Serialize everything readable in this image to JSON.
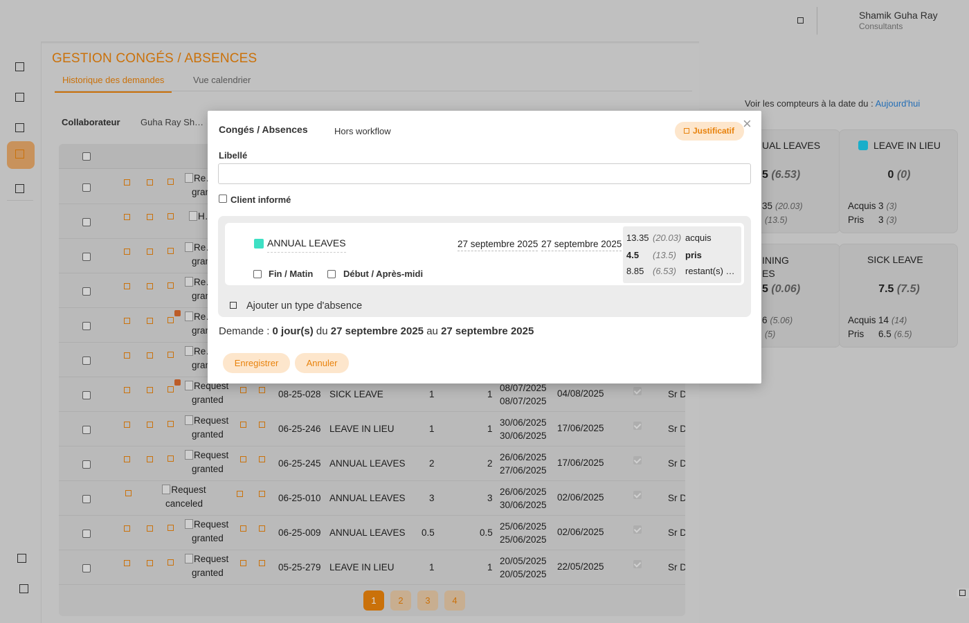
{
  "header": {
    "user_name": "Shamik Guha Ray",
    "user_role": "Consultants"
  },
  "page": {
    "title": "GESTION CONGÉS / ABSENCES",
    "tabs": [
      "Historique des demandes",
      "Vue calendrier"
    ],
    "filter_label": "Collaborateur",
    "filter_value": "Guha Ray Sh…"
  },
  "table": {
    "rows": [
      {
        "status": "Re…",
        "status2": "gran",
        "ref": "",
        "type": "",
        "q1": "",
        "q2": "",
        "dates": [
          "",
          ""
        ],
        "created": "",
        "approver": "",
        "dot": false
      },
      {
        "status": "H…",
        "status2": "",
        "ref": "",
        "type": "",
        "q1": "",
        "q2": "",
        "dates": [
          "",
          ""
        ],
        "created": "",
        "approver": "",
        "dot": false
      },
      {
        "status": "Re…",
        "status2": "gran",
        "ref": "",
        "type": "",
        "q1": "",
        "q2": "",
        "dates": [
          "",
          ""
        ],
        "created": "",
        "approver": "",
        "dot": false
      },
      {
        "status": "Re…",
        "status2": "gran",
        "ref": "",
        "type": "",
        "q1": "",
        "q2": "",
        "dates": [
          "",
          ""
        ],
        "created": "",
        "approver": "",
        "dot": false
      },
      {
        "status": "Re…",
        "status2": "gran",
        "ref": "",
        "type": "",
        "q1": "",
        "q2": "",
        "dates": [
          "",
          ""
        ],
        "created": "",
        "approver": "",
        "dot": true
      },
      {
        "status": "Re…",
        "status2": "gran",
        "ref": "",
        "type": "",
        "q1": "",
        "q2": "",
        "dates": [
          "",
          ""
        ],
        "created": "",
        "approver": "",
        "dot": false
      },
      {
        "status": "Request",
        "status2": "granted",
        "ref": "08-25-028",
        "type": "SICK LEAVE",
        "q1": "1",
        "q2": "1",
        "dates": [
          "08/07/2025",
          "08/07/2025"
        ],
        "created": "04/08/2025",
        "approver": "Sr D",
        "dot": true
      },
      {
        "status": "Request",
        "status2": "granted",
        "ref": "06-25-246",
        "type": "LEAVE IN LIEU",
        "q1": "1",
        "q2": "1",
        "dates": [
          "30/06/2025",
          "30/06/2025"
        ],
        "created": "17/06/2025",
        "approver": "Sr D",
        "dot": false
      },
      {
        "status": "Request",
        "status2": "granted",
        "ref": "06-25-245",
        "type": "ANNUAL LEAVES",
        "q1": "2",
        "q2": "2",
        "dates": [
          "26/06/2025",
          "27/06/2025"
        ],
        "created": "17/06/2025",
        "approver": "Sr D",
        "dot": false
      },
      {
        "status": "Request",
        "status2": "canceled",
        "ref": "06-25-010",
        "type": "ANNUAL LEAVES",
        "q1": "3",
        "q2": "3",
        "dates": [
          "26/06/2025",
          "30/06/2025"
        ],
        "created": "02/06/2025",
        "approver": "Sr D",
        "dot": false,
        "canceled": true
      },
      {
        "status": "Request",
        "status2": "granted",
        "ref": "06-25-009",
        "type": "ANNUAL LEAVES",
        "q1": "0.5",
        "q2": "0.5",
        "dates": [
          "25/06/2025",
          "25/06/2025"
        ],
        "created": "02/06/2025",
        "approver": "Sr D",
        "dot": false
      },
      {
        "status": "Request",
        "status2": "granted",
        "ref": "05-25-279",
        "type": "LEAVE IN LIEU",
        "q1": "1",
        "q2": "1",
        "dates": [
          "20/05/2025",
          "20/05/2025"
        ],
        "created": "22/05/2025",
        "approver": "Sr D",
        "dot": false
      }
    ],
    "pages": [
      "1",
      "2",
      "3",
      "4"
    ],
    "current_page": "1"
  },
  "counters": {
    "label": "Voir les compteurs à la date du :",
    "link": "Aujourd'hui",
    "cards": [
      {
        "title": "UAL LEAVES",
        "main": "5",
        "main_paren": "(6.53)",
        "rows": [
          [
            "",
            "35",
            "(20.03)"
          ],
          [
            "",
            "",
            "(13.5)"
          ]
        ],
        "swatch": ""
      },
      {
        "title": "LEAVE IN LIEU",
        "main": "0",
        "main_paren": "(0)",
        "rows": [
          [
            "Acquis",
            "3",
            "(3)"
          ],
          [
            "Pris",
            "3",
            "(3)"
          ]
        ],
        "swatch": "#1ec8e8"
      },
      {
        "title": "INING",
        "title2": "ES",
        "main": "5",
        "main_paren": "(0.06)",
        "rows": [
          [
            "",
            "6",
            "(5.06)"
          ],
          [
            "",
            "",
            "(5)"
          ]
        ],
        "swatch": ""
      },
      {
        "title": "SICK LEAVE",
        "main": "7.5",
        "main_paren": "(7.5)",
        "rows": [
          [
            "Acquis",
            "14",
            "(14)"
          ],
          [
            "Pris",
            "6.5",
            "(6.5)"
          ]
        ],
        "swatch": "#d4d4d4"
      }
    ]
  },
  "modal": {
    "title": "Congés / Absences",
    "workflow": "Hors workflow",
    "justif_button": "Justificatif",
    "close": "×",
    "libelle_label": "Libellé",
    "libelle_value": "",
    "client_label": "Client informé",
    "absence": {
      "type": "ANNUAL LEAVES",
      "type_color": "#3ee0c4",
      "date_start": "27 septembre 2025",
      "date_end": "27 septembre 2025",
      "fin_label": "Fin / Matin",
      "debut_label": "Début / Après-midi",
      "balance": [
        {
          "value": "13.35",
          "paren": "(20.03)",
          "key": "acquis"
        },
        {
          "value": "4.5",
          "paren": "(13.5)",
          "key": "pris"
        },
        {
          "value": "8.85",
          "paren": "(6.53)",
          "key": "restant(s) …"
        }
      ]
    },
    "add_label": "Ajouter un type d'absence",
    "summary": {
      "prefix": "Demande :",
      "days": "0 jour(s)",
      "du": "du",
      "from": "27 septembre 2025",
      "au": "au",
      "to": "27 septembre 2025"
    },
    "save": "Enregistrer",
    "cancel": "Annuler"
  }
}
